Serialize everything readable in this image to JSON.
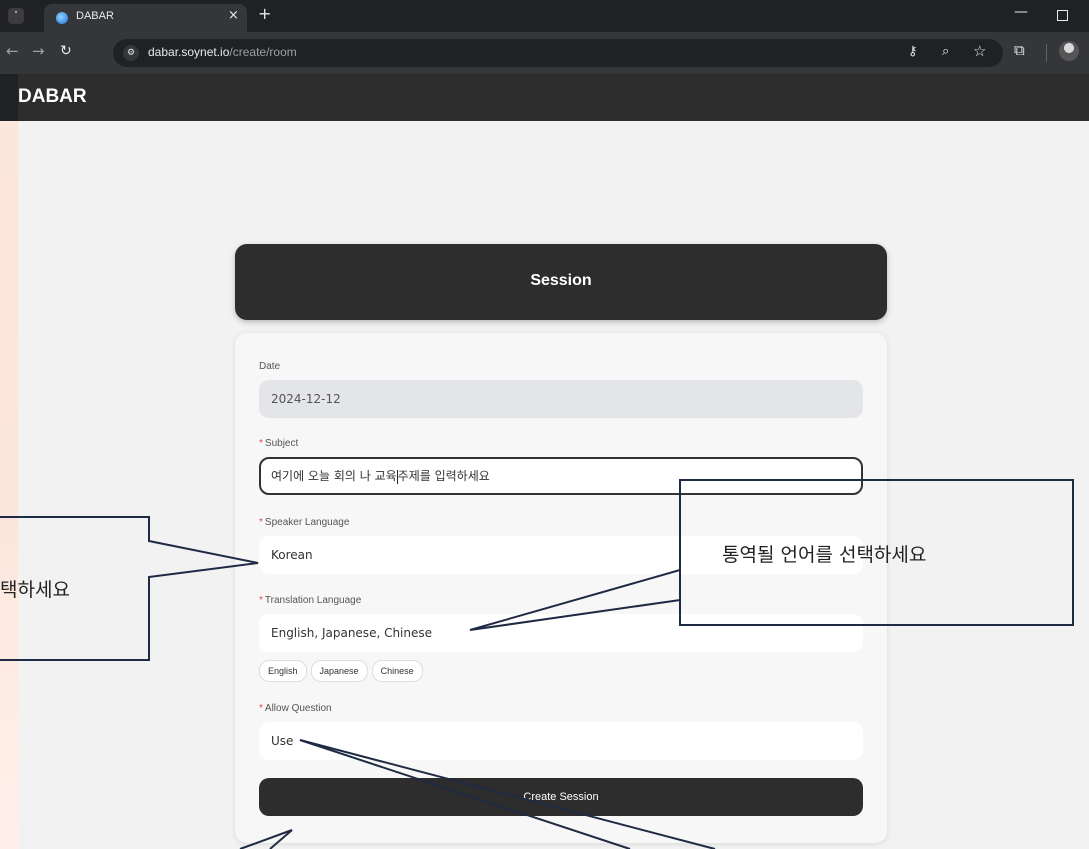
{
  "browser": {
    "tab_title": "DABAR",
    "tab_close": "×",
    "new_tab": "+",
    "menu_glyph": "˅",
    "url_host": "dabar.soynet.io",
    "url_path": "/create/room",
    "icons": [
      "chevron-down-icon",
      "favicon",
      "close-icon",
      "plus-icon",
      "back-arrow-icon",
      "forward-arrow-icon",
      "reload-icon",
      "site-settings-icon",
      "password-key-icon",
      "zoom-icon",
      "bookmark-star-icon",
      "extensions-icon",
      "profile-avatar",
      "minimize-icon",
      "maximize-icon"
    ]
  },
  "app": {
    "title": "DABAR"
  },
  "session": {
    "title": "Session",
    "fields": {
      "date": {
        "label": "Date",
        "value": "2024-12-12"
      },
      "subject": {
        "label": "Subject",
        "value_before_caret": "여기에 오늘 회의 나 교육",
        "value_after_caret": "주제를 입력하세요"
      },
      "speaker_language": {
        "label": "Speaker Language",
        "value": "Korean"
      },
      "translation_language": {
        "label": "Translation Language",
        "value": "English, Japanese, Chinese"
      },
      "allow_question": {
        "label": "Allow Question",
        "value": "Use"
      }
    },
    "required_marker": "*",
    "chips": [
      "English",
      "Japanese",
      "Chinese"
    ],
    "create_button": "Create Session"
  },
  "annotations": {
    "left_callout": "택하세요",
    "right_callout": "통역될 언어를 선택하세요"
  },
  "colors": {
    "browser_bg": "#202124",
    "header_bg": "#2d2d2d",
    "page_bg": "#f2f2f2",
    "required": "#e04a4a"
  }
}
